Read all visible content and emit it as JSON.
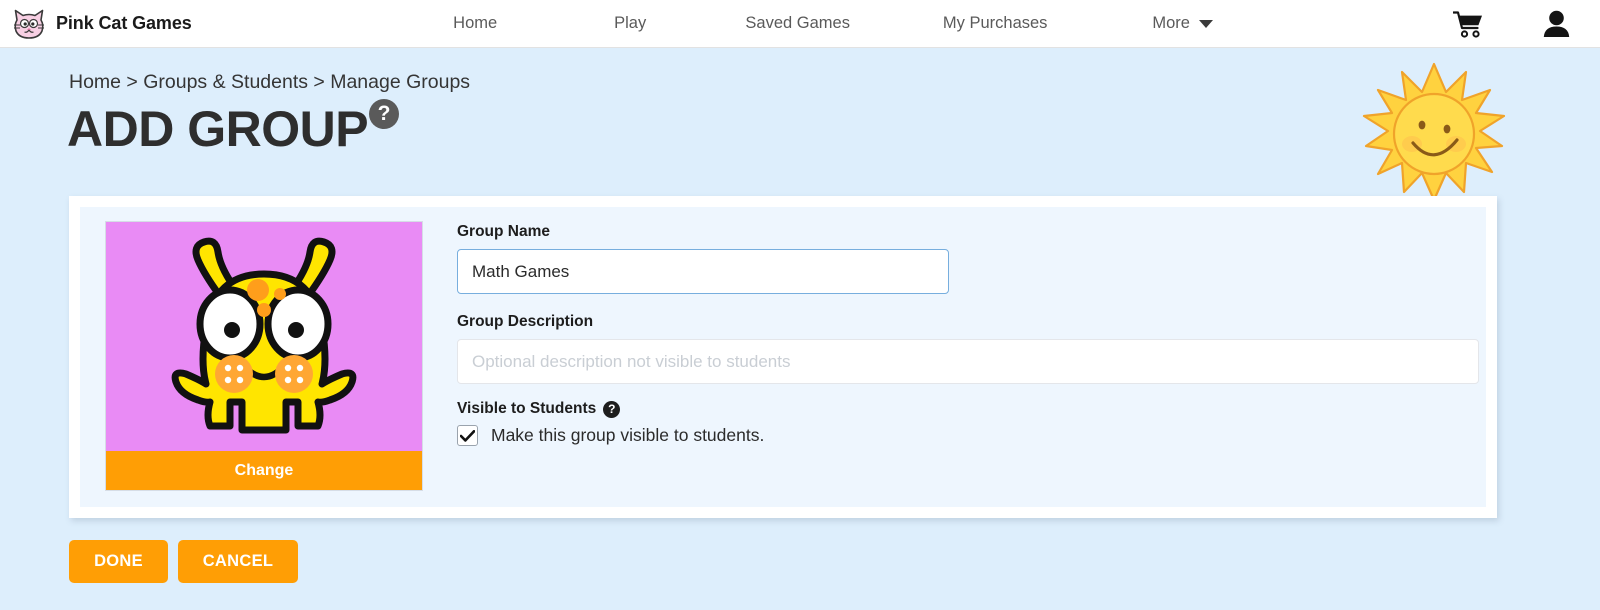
{
  "brand": {
    "name": "Pink Cat Games",
    "logo_icon": "pink-cat-logo-icon"
  },
  "nav": {
    "links": [
      {
        "label": "Home"
      },
      {
        "label": "Play"
      },
      {
        "label": "Saved Games"
      },
      {
        "label": "My Purchases"
      }
    ],
    "more": {
      "label": "More",
      "icon": "chevron-down-icon"
    },
    "icons": [
      {
        "name": "shopping-cart-icon"
      },
      {
        "name": "user-account-icon"
      }
    ]
  },
  "header": {
    "breadcrumb": "Home > Groups & Students > Manage Groups",
    "title": "ADD GROUP",
    "help_icon_label": "?",
    "sun_decoration": "smiling-sun-icon"
  },
  "card": {
    "avatar": {
      "art": "yellow-monster-avatar",
      "background_color": "#e98bf5",
      "change_label": "Change"
    },
    "group_name": {
      "label": "Group Name",
      "value": "Math Games",
      "placeholder": ""
    },
    "group_description": {
      "label": "Group Description",
      "value": "",
      "placeholder": "Optional description not visible to students"
    },
    "visible_to_students": {
      "label": "Visible to Students",
      "help_icon_label": "?",
      "checkbox_label": "Make this group visible to students.",
      "checked": true
    }
  },
  "footer": {
    "done_label": "DONE",
    "cancel_label": "CANCEL"
  },
  "colors": {
    "page_background": "#ddeefc",
    "card_interior": "#eef6fe",
    "accent_orange": "#ff9e05",
    "input_focus_border": "#77aede",
    "avatar_background": "#e98bf5"
  }
}
